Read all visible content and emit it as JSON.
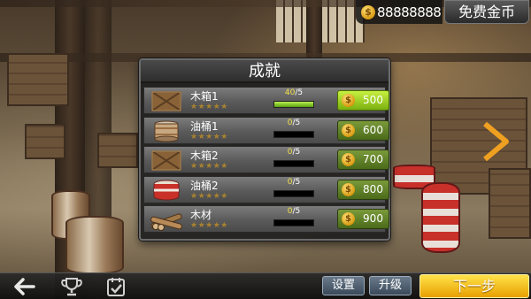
{
  "header": {
    "coin_icon": "dollar-coin-icon",
    "coin_symbol": "$",
    "coin_amount": "88888888",
    "free_coins_label": "免费金币"
  },
  "panel": {
    "title": "成就",
    "rows": [
      {
        "name": "木箱1",
        "icon": "wooden-crate-icon",
        "stars": "★★★★★",
        "progress_current": "40",
        "progress_total": "/5",
        "progress_fraction": 1.0,
        "reward": "500",
        "reward_active": true
      },
      {
        "name": "油桶1",
        "icon": "oil-barrel-icon",
        "stars": "★★★★★",
        "progress_current": "0",
        "progress_total": "/5",
        "progress_fraction": 0,
        "reward": "600",
        "reward_active": false
      },
      {
        "name": "木箱2",
        "icon": "wooden-crate-icon",
        "stars": "★★★★★",
        "progress_current": "0",
        "progress_total": "/5",
        "progress_fraction": 0,
        "reward": "700",
        "reward_active": false
      },
      {
        "name": "油桶2",
        "icon": "red-barrel-icon",
        "stars": "★★★★★",
        "progress_current": "0",
        "progress_total": "/5",
        "progress_fraction": 0,
        "reward": "800",
        "reward_active": false
      },
      {
        "name": "木材",
        "icon": "timber-logs-icon",
        "stars": "★★★★★",
        "progress_current": "0",
        "progress_total": "/5",
        "progress_fraction": 0,
        "reward": "900",
        "reward_active": false
      }
    ]
  },
  "bottom": {
    "back_icon": "back-arrow-icon",
    "trophy_icon": "trophy-icon",
    "checklist_icon": "checklist-icon",
    "settings_label": "设置",
    "upgrade_label": "升级",
    "next_label": "下一步"
  },
  "colors": {
    "accent_green": "#9ad820",
    "gold": "#f0b800",
    "arrow_orange": "#f0a020"
  }
}
